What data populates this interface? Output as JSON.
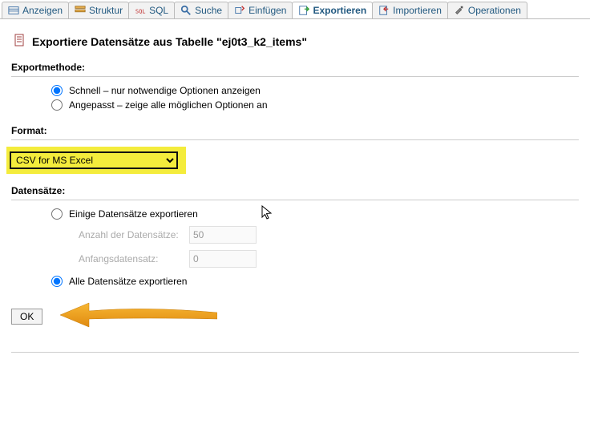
{
  "tabs": [
    {
      "label": "Anzeigen"
    },
    {
      "label": "Struktur"
    },
    {
      "label": "SQL"
    },
    {
      "label": "Suche"
    },
    {
      "label": "Einfügen"
    },
    {
      "label": "Exportieren"
    },
    {
      "label": "Importieren"
    },
    {
      "label": "Operationen"
    }
  ],
  "heading": "Exportiere Datensätze aus Tabelle \"ej0t3_k2_items\"",
  "export_method": {
    "title": "Exportmethode:",
    "quick": "Schnell – nur notwendige Optionen anzeigen",
    "custom": "Angepasst – zeige alle möglichen Optionen an"
  },
  "format": {
    "title": "Format:",
    "selected": "CSV for MS Excel"
  },
  "rows": {
    "title": "Datensätze:",
    "some": "Einige Datensätze exportieren",
    "count_label": "Anzahl der Datensätze:",
    "count_value": "50",
    "start_label": "Anfangsdatensatz:",
    "start_value": "0",
    "all": "Alle Datensätze exportieren"
  },
  "submit_label": "OK",
  "icons": {
    "browse": "browse-icon",
    "structure": "structure-icon",
    "sql": "sql-icon",
    "search": "search-icon",
    "insert": "insert-icon",
    "export": "export-icon",
    "import": "import-icon",
    "operations": "operations-icon"
  },
  "colors": {
    "highlight": "#f4ec3c",
    "arrow": "#f0a020",
    "link": "#235a81"
  }
}
